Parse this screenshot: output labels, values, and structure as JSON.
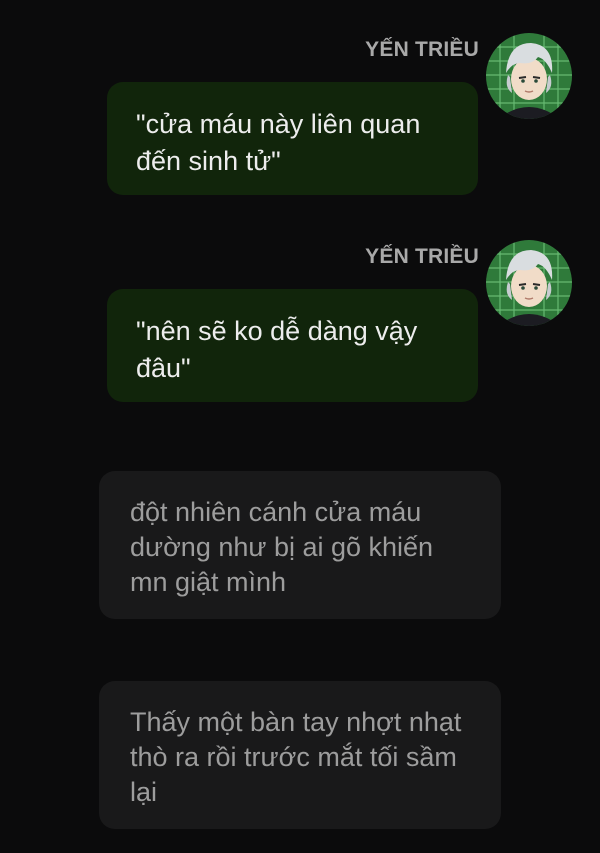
{
  "messages": [
    {
      "type": "character",
      "sender": "YẾN TRIỀU",
      "avatar_icon": "character-avatar-icon",
      "text": "\"cửa máu này liên quan đến sinh tử\""
    },
    {
      "type": "character",
      "sender": "YẾN TRIỀU",
      "avatar_icon": "character-avatar-icon",
      "text": "\"nên sẽ ko dễ dàng vậy đâu\""
    },
    {
      "type": "narration",
      "text": "đột nhiên cánh cửa máu dường như bị ai gõ khiến mn giật mình"
    },
    {
      "type": "narration",
      "text": "Thấy một bàn tay nhợt nhạt thò ra rồi trước mắt tối sầm lại"
    }
  ],
  "colors": {
    "background": "#0b0b0c",
    "character_bubble": "#11250b",
    "narration_bubble": "#19191a",
    "sender_name": "#a9a9a9",
    "character_text": "#ededed",
    "narration_text": "#9d9d9d"
  }
}
